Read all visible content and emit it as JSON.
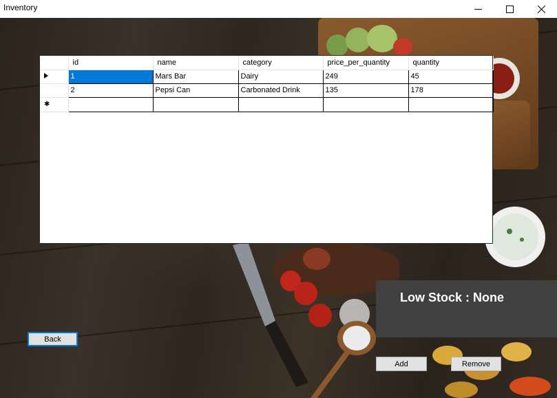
{
  "window": {
    "title": "Inventory"
  },
  "grid": {
    "columns": [
      "id",
      "name",
      "category",
      "price_per_quantity",
      "quantity"
    ],
    "rows": [
      [
        "1",
        "Mars Bar",
        "Dairy",
        "249",
        "45"
      ],
      [
        "2",
        "Pepsi Can",
        "Carbonated Drink",
        "135",
        "178"
      ]
    ]
  },
  "low_stock": {
    "label": "Low Stock : None"
  },
  "buttons": {
    "back": "Back",
    "add": "Add",
    "remove": "Remove"
  },
  "colors": {
    "selection": "#0078d7",
    "panel": "#404040"
  }
}
